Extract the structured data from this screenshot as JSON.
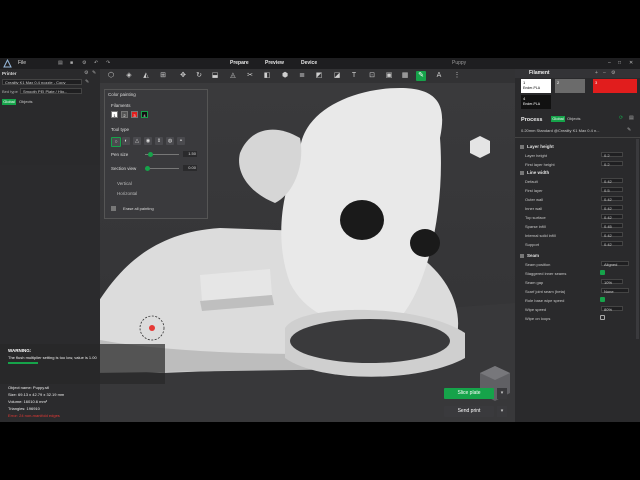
{
  "titlebar": {
    "menu_file": "File",
    "tabs": [
      "Prepare",
      "Preview",
      "Device"
    ],
    "project": "Puppy"
  },
  "printer": {
    "heading": "Printer",
    "printer_name": "Creality K1 Max 0.4 nozzle - Copy",
    "bed_type_label": "Bed type",
    "bed_type_value": "Smooth PEI Plate / Hig...",
    "tabs": [
      "Global",
      "Objects"
    ]
  },
  "paint": {
    "title": "Color painting",
    "filaments_label": "Filaments",
    "filament_numbers": [
      "1",
      "2",
      "3",
      "4"
    ],
    "tool_type_label": "Tool type",
    "pen_size_label": "Pen size",
    "pen_size_value": "1.50",
    "section_view_label": "Section view",
    "section_view_value": "0.00",
    "vertical_label": "Vertical",
    "horizontal_label": "Horizontal",
    "erase_label": "Erase all painting"
  },
  "warning": {
    "title": "WARNING:",
    "message": "The flush multiplier setting is too low, value is 1.00",
    "object_name": "Object name: Puppy.stl",
    "size": "Size: 69.13 x 42.79 x 32.19 mm",
    "volume": "Volume: 16010.6 mm³",
    "triangles": "Triangles: 196910",
    "errors": "Error: 24 non-manifold edges"
  },
  "filament": {
    "heading": "Filament",
    "slots": [
      {
        "num": "1",
        "name": "Ender-PLA",
        "color": "#ffffff"
      },
      {
        "num": "2",
        "name": "",
        "color": "#6b6b6b"
      },
      {
        "num": "3",
        "name": "",
        "color": "#e11d1d"
      },
      {
        "num": "4",
        "name": "Ender-PLA",
        "color": "#111111"
      }
    ]
  },
  "process": {
    "heading": "Process",
    "tabs": [
      "Global",
      "Objects"
    ],
    "preset": "0.20mm Standard @Creality K1 Max 0.4 n...",
    "layer_height_heading": "Layer height",
    "layer_height_rows": [
      {
        "label": "Layer height",
        "value": "0.2"
      },
      {
        "label": "First layer height",
        "value": "0.2"
      }
    ],
    "line_width_heading": "Line width",
    "line_width_rows": [
      {
        "label": "Default",
        "value": "0.42"
      },
      {
        "label": "First layer",
        "value": "0.5"
      },
      {
        "label": "Outer wall",
        "value": "0.42"
      },
      {
        "label": "Inner wall",
        "value": "0.42"
      },
      {
        "label": "Top surface",
        "value": "0.42"
      },
      {
        "label": "Sparse infill",
        "value": "0.45"
      },
      {
        "label": "Internal solid infill",
        "value": "0.42"
      },
      {
        "label": "Support",
        "value": "0.42"
      }
    ],
    "seam_heading": "Seam",
    "seam_rows": [
      {
        "label": "Seam position",
        "value": "Aligned"
      },
      {
        "label": "Staggered inner seams",
        "value": ""
      },
      {
        "label": "Seam gap",
        "value": "10%"
      },
      {
        "label": "Scarf joint seam (beta)",
        "value": "None"
      },
      {
        "label": "Role base wipe speed",
        "value": ""
      },
      {
        "label": "Wipe speed",
        "value": "80%"
      },
      {
        "label": "Wipe on loops",
        "value": ""
      }
    ]
  },
  "actions": {
    "slice_label": "Slice plate",
    "send_label": "Send print"
  },
  "colors": {
    "accent": "#16a34a",
    "background": "#2b2b2d",
    "model": "#e8e8e8"
  }
}
